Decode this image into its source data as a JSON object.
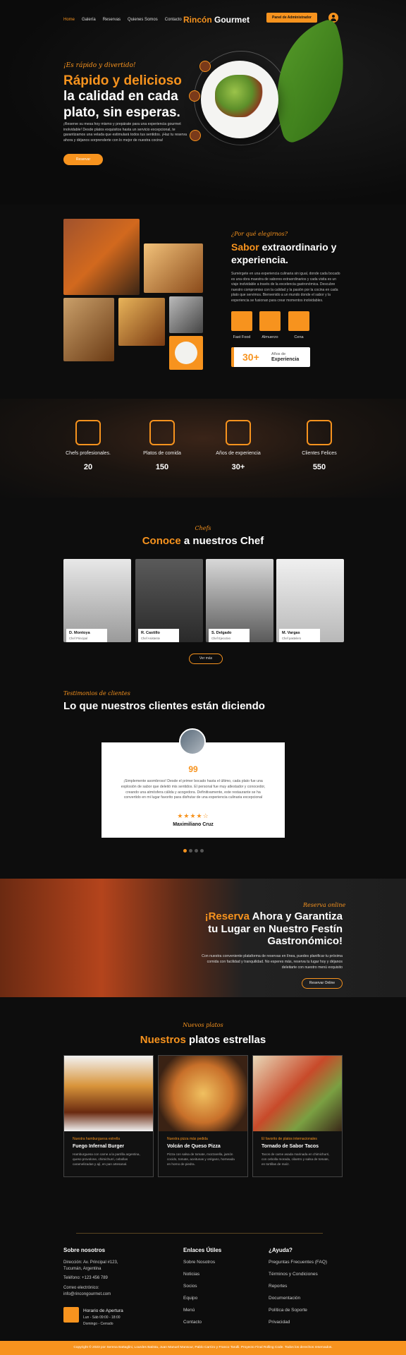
{
  "nav": {
    "links": [
      "Home",
      "Galería",
      "Reservas",
      "Quienes Somos",
      "Contacto"
    ],
    "brand_first": "Rincón",
    "brand_second": "Gourmet",
    "admin_button": "Panel de Administrador"
  },
  "hero": {
    "kicker": "¡Es rápido y divertido!",
    "title_highlight": "Rápido y delicioso",
    "title_rest": "la calidad en cada plato, sin esperas.",
    "text": "¡Reserve su mesa hoy mismo y prepárate para una experiencia gourmet inolvidable! Desde platos exquisitos hasta un servicio excepcional, te garantizamos una velada que estimulará todos tus sentidos. ¡Haz tu reserva ahora y déjanos sorprenderte con lo mejor de nuestra cocina!",
    "button": "Reservar"
  },
  "about": {
    "kicker": "¿Por qué elegirnos?",
    "title_highlight": "Sabor",
    "title_rest": "extraordinario y experiencia.",
    "text": "Sumérgete en una experiencia culinaria sin igual, donde cada bocado es una obra maestra de sabores extraordinarios y cada visita es un viaje inolvidable a través de la excelencia gastronómica. Descubre nuestro compromiso con la calidad y la pasión por la cocina en cada plato que servimos. Bienvenido a un mundo donde el sabor y la experiencia se fusionan para crear momentos inolvidables.",
    "categories": [
      "Fast Food",
      "Almuerzo",
      "Cena"
    ],
    "years_value": "30+",
    "years_small": "Años de",
    "years_big": "Experiencia"
  },
  "stats": [
    {
      "label": "Chefs profesionales.",
      "value": "20",
      "icon": "chef-hat-icon"
    },
    {
      "label": "Platos de comida",
      "value": "150",
      "icon": "burger-icon"
    },
    {
      "label": "Años de experiencia",
      "value": "30+",
      "icon": "utensils-icon"
    },
    {
      "label": "Clientes Felices",
      "value": "550",
      "icon": "pizza-icon"
    }
  ],
  "chefs": {
    "kicker": "Chefs",
    "title_highlight": "Conoce",
    "title_rest": "a nuestros Chef",
    "items": [
      {
        "name": "D. Montoya",
        "role": "Chef Principal"
      },
      {
        "name": "R. Castillo",
        "role": "Chef Asistente"
      },
      {
        "name": "S. Delgado",
        "role": "Chef Ejecutivo"
      },
      {
        "name": "M. Vargas",
        "role": "Chef pastelero"
      }
    ],
    "button": "Ver más"
  },
  "testimonials": {
    "kicker": "Testimonios de clientes",
    "title": "Lo que nuestros clientes están diciendo",
    "quote_mark": "99",
    "text": "¡Simplemente asombroso! Desde el primer bocado hasta el último, cada plato fue una explosión de sabor que deleitó mis sentidos. El personal fue muy atlestador y conocedor, creando una atmósfera cálida y acogedora. Definitivamente, este restaurante se ha convertido en mi lugar favorito para disfrutar de una experiencia culinaria excepcional",
    "stars": "★★★★☆",
    "rating": 4,
    "name": "Maximiliano Cruz"
  },
  "reserve": {
    "kicker": "Reserva online",
    "title_highlight": "¡Reserva",
    "title_rest": "Ahora y Garantiza tu Lugar en Nuestro Festín Gastronómico!",
    "text": "Con nuestra conveniente plataforma de reservas en línea, puedes planificar tu próxima comida con facilidad y tranquilidad. No esperes más, reserva tu lugar hoy y déjanos deleitarte con nuestro menú exquisito",
    "button": "Reservar Online"
  },
  "dishes": {
    "kicker": "Nuevos platos",
    "title_highlight": "Nuestros",
    "title_rest": "platos estrellas",
    "items": [
      {
        "sub": "Nuestra hamburguesa estrella",
        "name": "Fuego Infernal Burger",
        "desc": "Hamburguesa con carne a la parrilla argentina, queso provolone, chimichurri, cebollas caramelizadas y ají, en pan artesanal."
      },
      {
        "sub": "Nuestra pizza más pedida",
        "name": "Volcán de Queso Pizza",
        "desc": "Pizza con salsa de tomate, mozzarella, jamón cocido, tomate, aceitunas y orégano, horneada en horno de piedra."
      },
      {
        "sub": "El favorito de platos internacionales",
        "name": "Tornado de Sabor Tacos",
        "desc": "Tacos de carne asada marinada en chimichurri, con cebolla morada, cilantro y salsa de tomate, en tortillas de maíz."
      }
    ]
  },
  "footer": {
    "about_title": "Sobre nosotros",
    "address": "Dirección: Av. Principal #123, Tucumán, Argentina",
    "phone": "Teléfono: +123 456 789",
    "email_label": "Correo electrónico:",
    "email": "info@rincongourmet.com",
    "hours_title": "Horario de Apertura",
    "hours_week": "Lun - Sáb 09:00 - 18:00",
    "hours_sun": "Domingo - Cerrado",
    "links_title": "Enlaces Útiles",
    "links": [
      "Sobre Nosotros",
      "Noticias",
      "Socios",
      "Equipo",
      "Menú",
      "Contacto"
    ],
    "help_title": "¿Ayuda?",
    "help": [
      "Preguntas Frecuentes (FAQ)",
      "Términos y Condiciones",
      "Reportes",
      "Documentación",
      "Política de Soporte",
      "Privacidad"
    ],
    "copyright": "Copyright © 2023 por Serena Battaglini, Lourdes Batista, Juan Manuel Mansour, Pablo Carrizo y Franco Tarulli. Proyecto Final Rolling Code. Todos los derechos reservados."
  },
  "colors": {
    "accent": "#f7931e",
    "background": "#0d0d0d"
  }
}
